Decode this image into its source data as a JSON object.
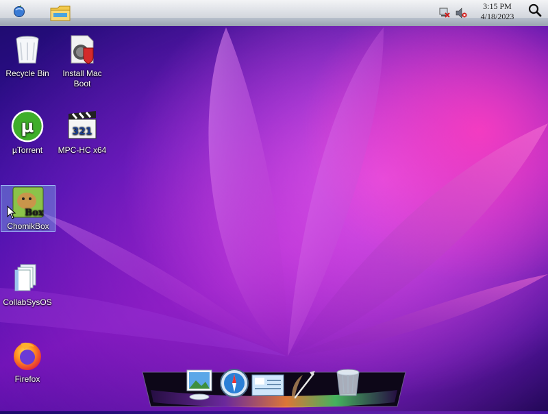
{
  "menubar": {
    "apple_icon": "apple-icon",
    "folder_icon": "file-explorer-icon",
    "tray": [
      "network-disconnected-icon",
      "volume-muted-icon"
    ],
    "clock": {
      "time": "3:15 PM",
      "date": "4/18/2023"
    },
    "search_icon": "search-icon"
  },
  "desktop": {
    "icons": [
      {
        "label": "Recycle Bin",
        "icon": "recycle-bin-icon"
      },
      {
        "label": "Install Mac Boot",
        "icon": "installer-icon"
      },
      {
        "label": "µTorrent",
        "icon": "utorrent-icon"
      },
      {
        "label": "MPC-HC x64",
        "icon": "mpc-hc-icon"
      },
      {
        "label": "ChomikBox",
        "icon": "chomikbox-icon",
        "selected": true
      },
      {
        "label": "CollabSysOS",
        "icon": "documents-icon"
      },
      {
        "label": "Firefox",
        "icon": "firefox-icon"
      }
    ]
  },
  "dock": {
    "items": [
      "photo-preview-icon",
      "safari-compass-icon",
      "mail-icon",
      "quill-pen-icon",
      "trash-icon"
    ]
  },
  "colors": {
    "menubar": "#d9dce2",
    "wallpaper_dark": "#1c0b6a",
    "wallpaper_pink": "#ec5aec",
    "selection": "#78aae6"
  }
}
